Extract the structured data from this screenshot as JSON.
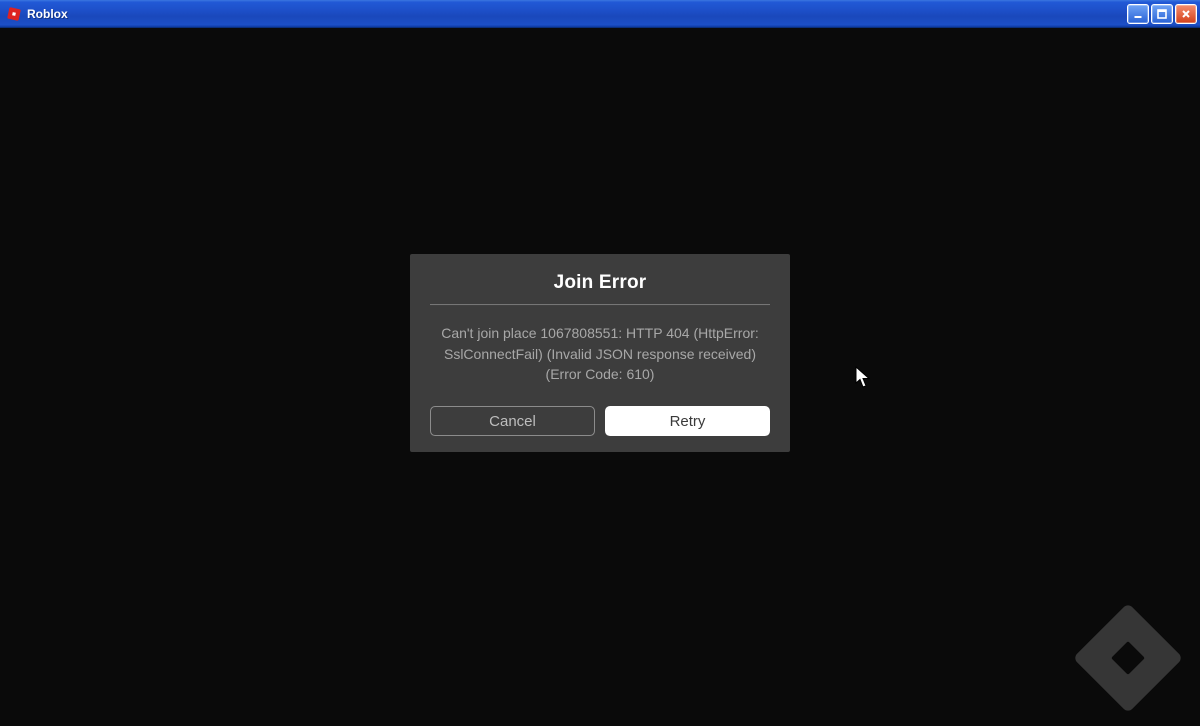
{
  "window": {
    "title": "Roblox"
  },
  "dialog": {
    "title": "Join Error",
    "message": "Can't join place 1067808551: HTTP 404 (HttpError: SslConnectFail) (Invalid JSON response received) (Error Code: 610)",
    "cancel_label": "Cancel",
    "retry_label": "Retry"
  }
}
